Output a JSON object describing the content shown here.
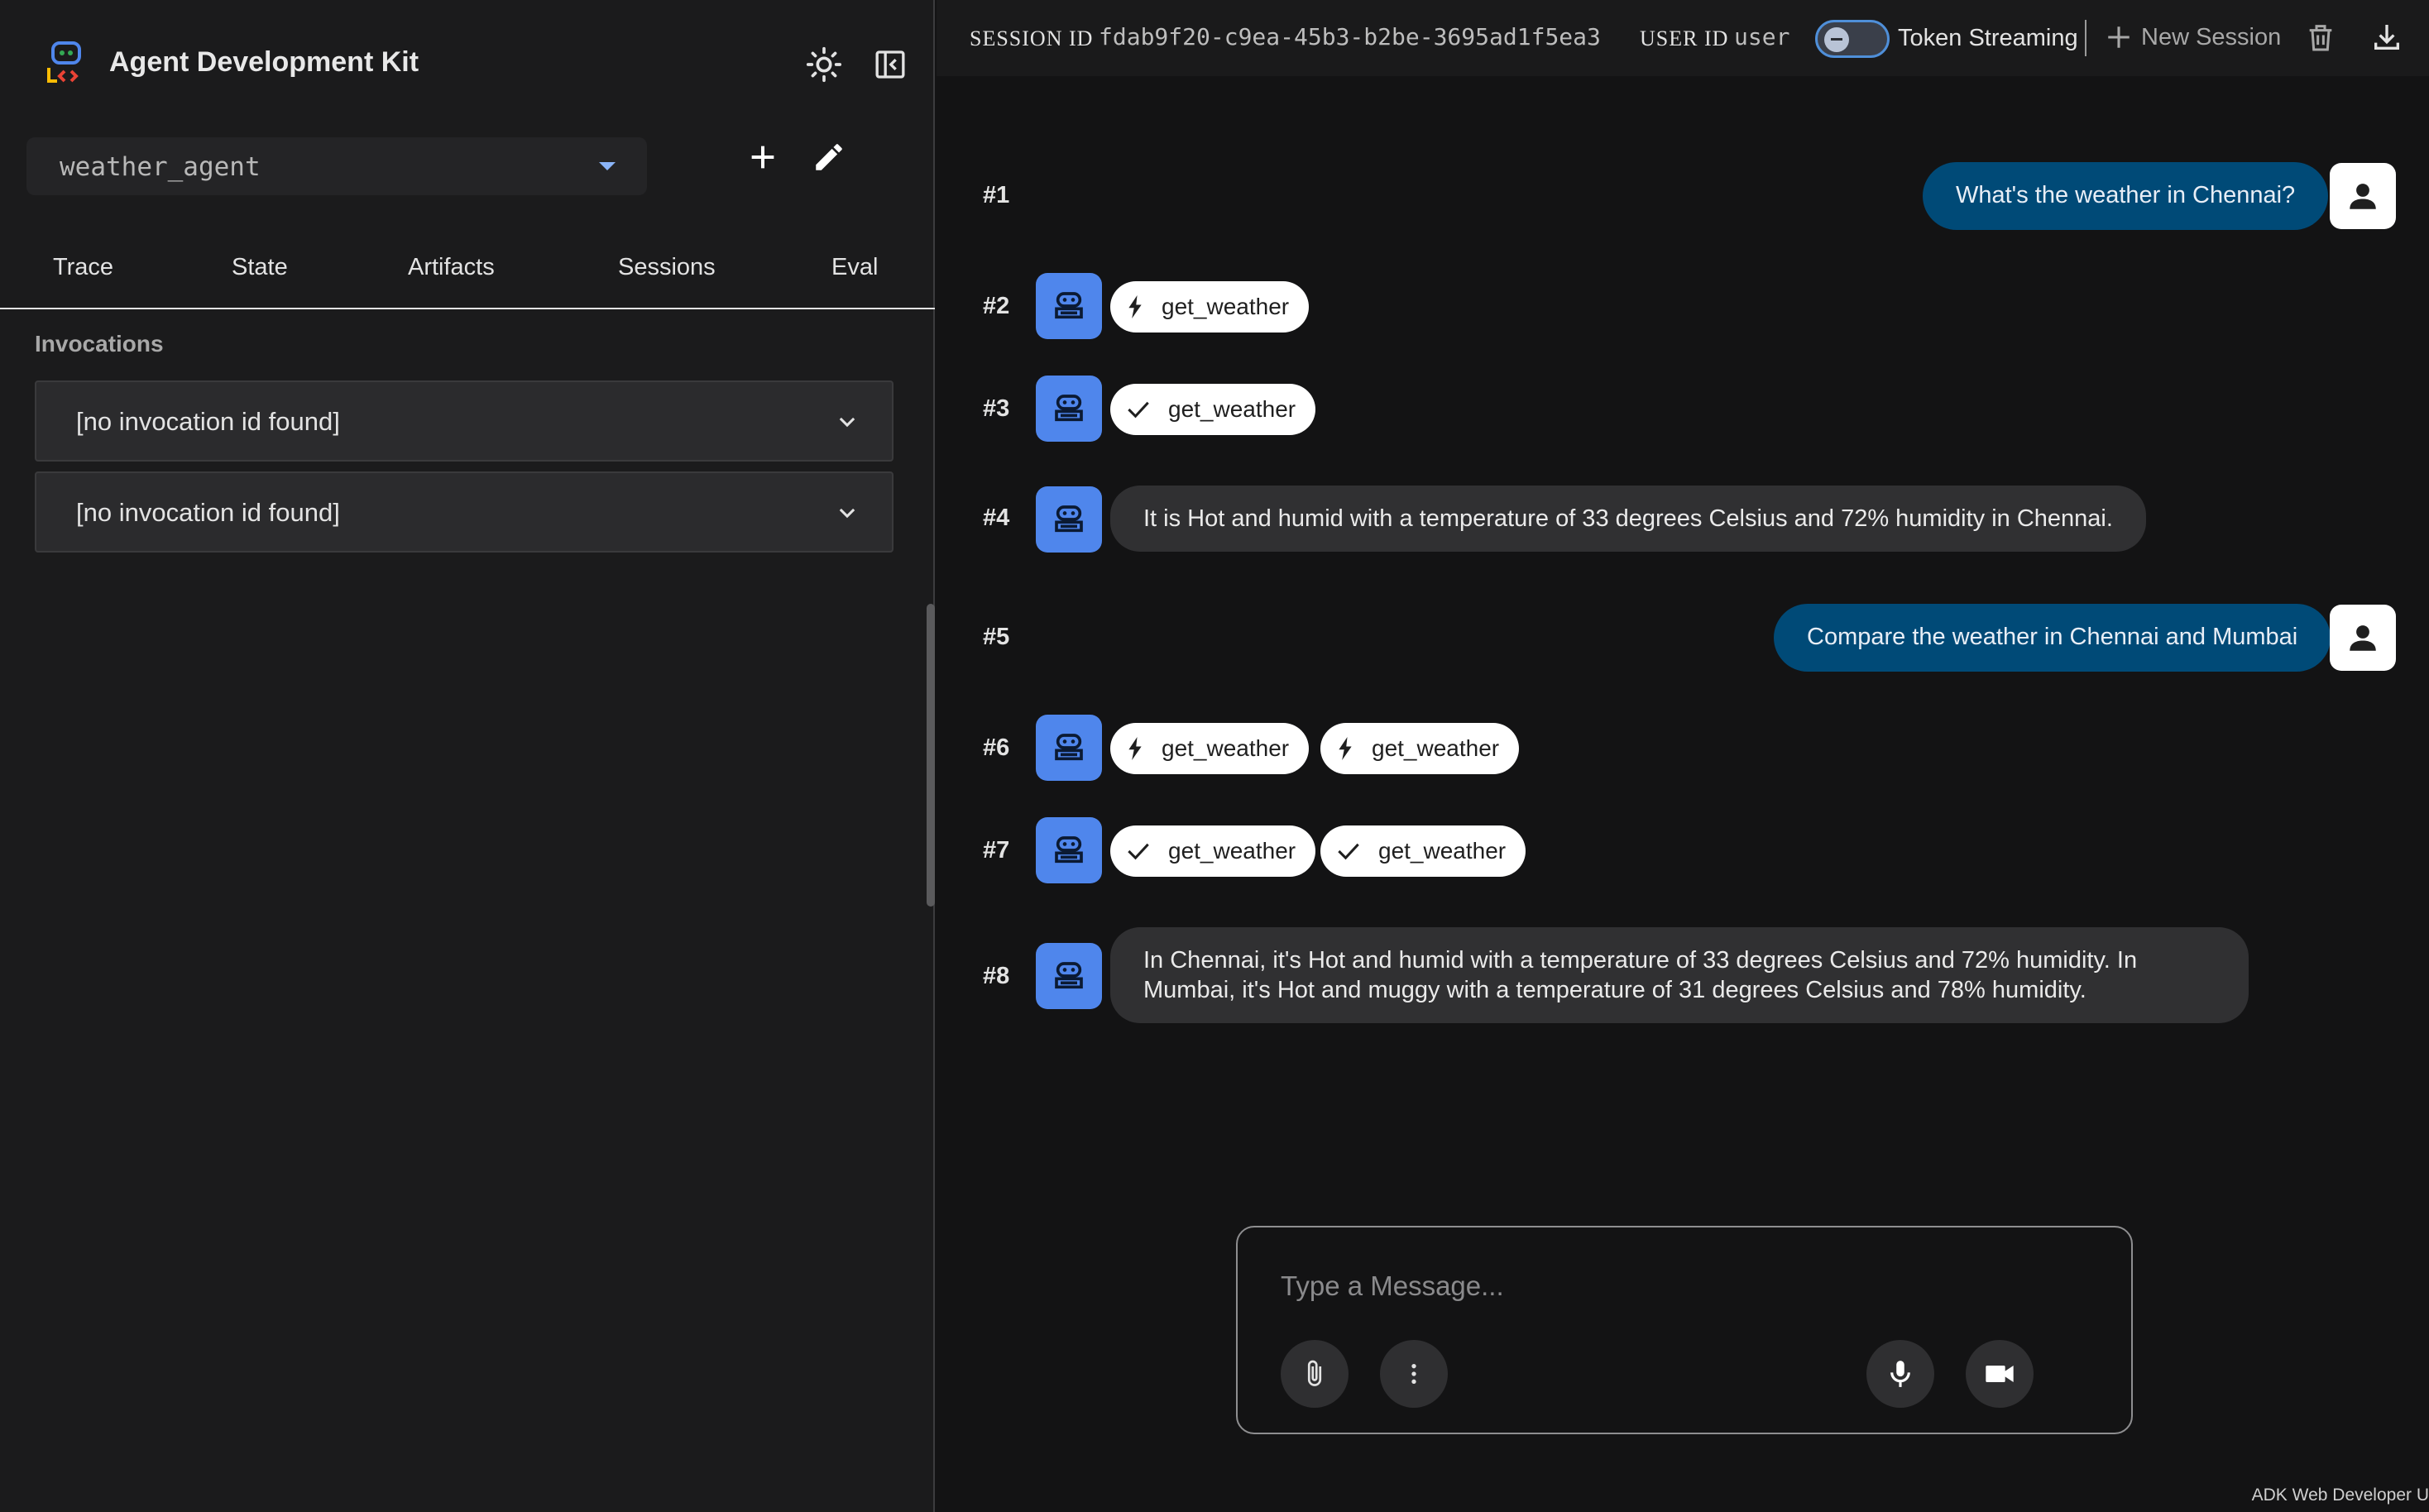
{
  "app": {
    "title": "Agent Development Kit"
  },
  "sidebar": {
    "agent_select": {
      "value": "weather_agent"
    },
    "tabs": [
      {
        "label": "Trace"
      },
      {
        "label": "State"
      },
      {
        "label": "Artifacts"
      },
      {
        "label": "Sessions"
      },
      {
        "label": "Eval"
      }
    ],
    "section_label": "Invocations",
    "invocations": [
      {
        "label": "[no invocation id found]"
      },
      {
        "label": "[no invocation id found]"
      }
    ]
  },
  "topbar": {
    "session_id_label": "SESSION ID",
    "session_id": "fdab9f20-c9ea-45b3-b2be-3695ad1f5ea3",
    "user_id_label": "USER ID",
    "user_id": "user",
    "token_streaming_label": "Token Streaming",
    "new_session_label": "New Session"
  },
  "messages": [
    {
      "num": "#1",
      "text": "What's the weather in Chennai?"
    },
    {
      "num": "#2",
      "chips": [
        "get_weather"
      ]
    },
    {
      "num": "#3",
      "chips": [
        "get_weather"
      ]
    },
    {
      "num": "#4",
      "text": "It is Hot and humid with a temperature of 33 degrees Celsius and 72% humidity in Chennai."
    },
    {
      "num": "#5",
      "text": "Compare the weather in Chennai and Mumbai"
    },
    {
      "num": "#6",
      "chips": [
        "get_weather",
        "get_weather"
      ]
    },
    {
      "num": "#7",
      "chips": [
        "get_weather",
        "get_weather"
      ]
    },
    {
      "num": "#8",
      "text": "In Chennai, it's Hot and humid with a temperature of 33 degrees Celsius and 72% humidity. In Mumbai, it's Hot and muggy with a temperature of 31 degrees Celsius and 78% humidity."
    }
  ],
  "composer": {
    "placeholder": "Type a Message..."
  },
  "footer": "ADK Web Developer U",
  "colors": {
    "accent": "#8ab4f8",
    "bot_avatar": "#4f86ec",
    "user_bubble": "#004a77",
    "bot_bubble": "#303032"
  },
  "icons": [
    "logo-icon",
    "theme-sun-icon",
    "collapse-sidebar-icon",
    "add-icon",
    "edit-icon",
    "chevron-down-icon",
    "plus-icon",
    "delete-icon",
    "download-icon",
    "bot-icon",
    "person-icon",
    "bolt-icon",
    "check-icon",
    "attach-icon",
    "more-vert-icon",
    "mic-icon",
    "videocam-icon"
  ]
}
